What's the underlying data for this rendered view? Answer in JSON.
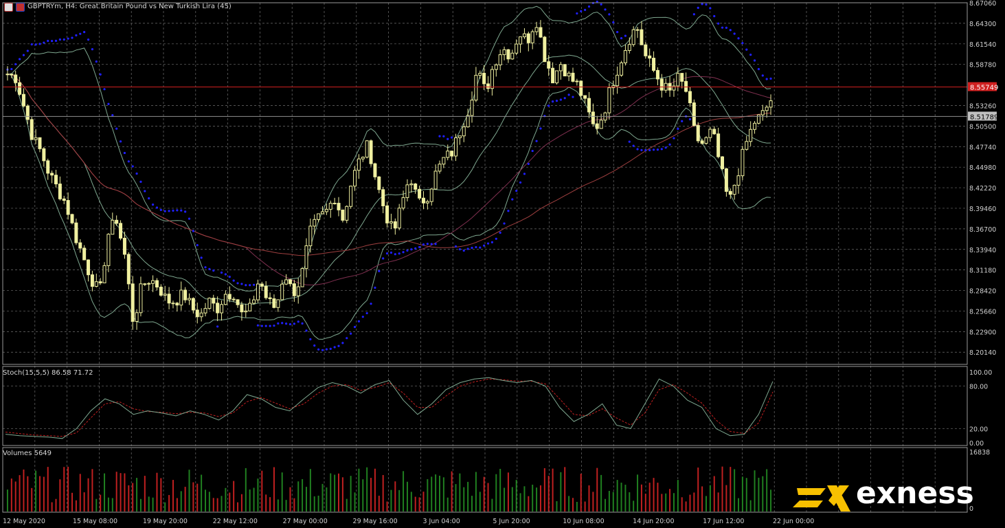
{
  "chart_title": "GBPTRYm, H4:  Great Britain Pound vs New Turkish Lira (45)",
  "stoch_label": "Stoch(15,5,5) 86.58 71.72",
  "volumes_label": "Volumes 5649",
  "brand": "exness",
  "colors": {
    "background": "#000000",
    "grid": "#707070",
    "candle": "#f0f0a0",
    "psar": "#2020ff",
    "bollinger": "#7fa890",
    "ma_long": "#803050",
    "ma_slow": "#a04040",
    "price_line": "#d02020",
    "bid_line": "#909090",
    "stoch_main": "#7fa890",
    "stoch_signal": "#c02020",
    "vol_up": "#208020",
    "vol_down": "#c02020",
    "price_tag_red": "#d02020",
    "price_tag_gray": "#c0c0c0"
  },
  "chart_data": {
    "type": "candlestick",
    "symbol": "GBPTRYm",
    "timeframe": "H4",
    "x_tick_labels": [
      "12 May 2020",
      "15 May 08:00",
      "19 May 20:00",
      "22 May 12:00",
      "27 May 00:00",
      "29 May 16:00",
      "3 Jun 04:00",
      "5 Jun 20:00",
      "10 Jun 08:00",
      "14 Jun 20:00",
      "17 Jun 12:00",
      "22 Jun 00:00"
    ],
    "price_ticks": [
      "8.67060",
      "8.64300",
      "8.61540",
      "8.58780",
      "8.53260",
      "8.50500",
      "8.47740",
      "8.44980",
      "8.42220",
      "8.39460",
      "8.36700",
      "8.33940",
      "8.31180",
      "8.28420",
      "8.25660",
      "8.22900",
      "8.20140"
    ],
    "ylim": [
      8.185,
      8.6706
    ],
    "current_price_tag": "8.55749",
    "bid_price_tag": "8.51789",
    "current_price": 8.55749,
    "bid_price": 8.51789,
    "price_path": [
      8.575,
      8.57,
      8.53,
      8.49,
      8.47,
      8.44,
      8.42,
      8.4,
      8.36,
      8.33,
      8.3,
      8.28,
      8.36,
      8.38,
      8.33,
      8.24,
      8.29,
      8.3,
      8.29,
      8.27,
      8.27,
      8.28,
      8.26,
      8.25,
      8.27,
      8.26,
      8.28,
      8.28,
      8.25,
      8.26,
      8.3,
      8.27,
      8.26,
      8.31,
      8.28,
      8.3,
      8.36,
      8.38,
      8.39,
      8.41,
      8.38,
      8.43,
      8.46,
      8.48,
      8.43,
      8.39,
      8.36,
      8.4,
      8.44,
      8.4,
      8.41,
      8.44,
      8.46,
      8.47,
      8.5,
      8.53,
      8.58,
      8.55,
      8.59,
      8.61,
      8.6,
      8.63,
      8.62,
      8.65,
      8.6,
      8.57,
      8.59,
      8.57,
      8.56,
      8.53,
      8.5,
      8.52,
      8.56,
      8.59,
      8.62,
      8.64,
      8.6,
      8.58,
      8.56,
      8.55,
      8.57,
      8.55,
      8.49,
      8.48,
      8.5,
      8.45,
      8.4,
      8.44,
      8.48,
      8.51,
      8.52,
      8.54
    ],
    "stochastic": {
      "params": "15,5,5",
      "main_value": 86.58,
      "signal_value": 71.72,
      "y_ticks": [
        "100.00",
        "80.00",
        "20.00",
        "0.00"
      ],
      "main": [
        12,
        10,
        9,
        8,
        6,
        20,
        45,
        62,
        55,
        40,
        45,
        42,
        38,
        45,
        40,
        32,
        45,
        68,
        62,
        50,
        45,
        62,
        78,
        85,
        80,
        70,
        82,
        88,
        60,
        40,
        55,
        75,
        85,
        90,
        92,
        88,
        85,
        88,
        80,
        50,
        30,
        40,
        55,
        25,
        20,
        55,
        90,
        80,
        60,
        50,
        20,
        10,
        12,
        40,
        86.58
      ],
      "signal": [
        15,
        13,
        11,
        10,
        9,
        14,
        35,
        55,
        58,
        48,
        44,
        43,
        41,
        43,
        42,
        37,
        42,
        58,
        64,
        56,
        48,
        55,
        70,
        80,
        82,
        74,
        78,
        85,
        70,
        50,
        50,
        66,
        80,
        86,
        90,
        89,
        87,
        87,
        83,
        62,
        40,
        38,
        48,
        35,
        25,
        42,
        75,
        82,
        70,
        56,
        32,
        16,
        13,
        28,
        71.72
      ]
    },
    "volumes": {
      "y_ticks": [
        "16838",
        "0"
      ],
      "last_value": 5649
    }
  }
}
